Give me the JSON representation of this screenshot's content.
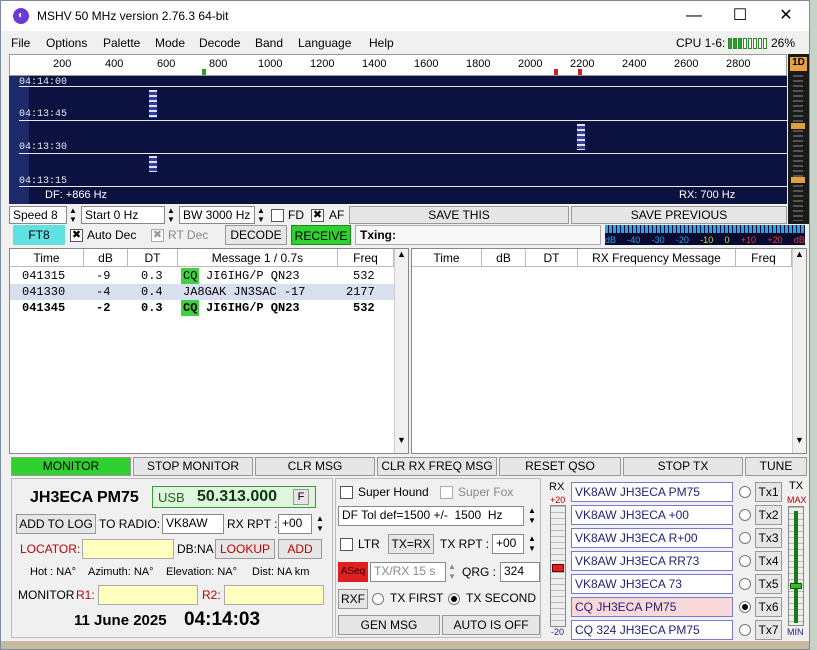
{
  "window": {
    "title": "MSHV 50 MHz version 2.76.3 64-bit",
    "minimize_icon": "minimize-icon",
    "maximize_icon": "maximize-icon",
    "close_icon": "close-icon"
  },
  "menu": [
    "File",
    "Options",
    "Palette",
    "Mode",
    "Decode",
    "Band",
    "Language",
    "Help"
  ],
  "cpu": {
    "label": "CPU 1-6:",
    "percent": "26%",
    "level": 0.26
  },
  "scale": {
    "ticks": [
      "200",
      "400",
      "600",
      "800",
      "1000",
      "1200",
      "1400",
      "1600",
      "1800",
      "2000",
      "2200",
      "2400",
      "2600",
      "2800"
    ]
  },
  "waterfall": {
    "times": [
      "04:14:00",
      "04:13:45",
      "04:13:30",
      "04:13:15"
    ],
    "df": "DF: +866 Hz",
    "rx": "RX: 700 Hz",
    "mode_badge": "1D"
  },
  "controls": {
    "speed": "Speed 8",
    "start": "Start 0 Hz",
    "bw": "BW 3000 Hz",
    "fd": "FD",
    "af": "AF",
    "save_this": "SAVE THIS",
    "save_previous": "SAVE PREVIOUS"
  },
  "status": {
    "mode": "FT8",
    "auto_dec": "Auto Dec",
    "rt_dec": "RT Dec",
    "decode": "DECODE",
    "receive": "RECEIVE",
    "txing": "Txing:",
    "level_scale": [
      "dB",
      "-40",
      "-30",
      "-20",
      "-10",
      "0",
      "+10",
      "+20",
      "dB"
    ]
  },
  "left_table": {
    "headers": [
      "Time",
      "dB",
      "DT",
      "Message 1 / 0.7s",
      "Freq"
    ],
    "rows": [
      {
        "time": "041315",
        "db": "-9",
        "dt": "0.3",
        "cq": "CQ",
        "msg": "JI6IHG/P QN23",
        "freq": "532"
      },
      {
        "time": "041330",
        "db": "-4",
        "dt": "0.4",
        "cq": "",
        "msg": "JA8GAK JN3SAC -17",
        "freq": "2177"
      },
      {
        "time": "041345",
        "db": "-2",
        "dt": "0.3",
        "cq": "CQ",
        "msg": "JI6IHG/P QN23",
        "freq": "532"
      }
    ]
  },
  "right_table": {
    "headers": [
      "Time",
      "dB",
      "DT",
      "RX Frequency Message",
      "Freq"
    ]
  },
  "buttons": {
    "monitor": "MONITOR",
    "stop_monitor": "STOP MONITOR",
    "clr_msg": "CLR MSG",
    "clr_rx": "CLR RX FREQ MSG",
    "reset_qso": "RESET QSO",
    "stop_tx": "STOP TX",
    "tune": "TUNE"
  },
  "station": {
    "call_grid": "JH3ECA PM75",
    "mode": "USB",
    "freq": "50.313.000",
    "f_btn": "F",
    "add_to_log": "ADD TO LOG",
    "to_radio_label": "TO RADIO:",
    "to_radio": "VK8AW",
    "rx_rpt_label": "RX RPT :",
    "rx_rpt": "+00",
    "locator_label": "LOCATOR:",
    "db_label": "DB:NA",
    "lookup": "LOOKUP",
    "add": "ADD",
    "hot": "Hot : NA°",
    "azimuth": "Azimuth: NA°",
    "elevation": "Elevation: NA°",
    "dist": "Dist: NA km",
    "monitor_label": "MONITOR",
    "r1": "R1:",
    "r2": "R2:",
    "date": "11 June 2025",
    "time": "04:14:03"
  },
  "options": {
    "super_hound": "Super Hound",
    "super_fox": "Super Fox",
    "df_tol": "DF Tol def=1500 +/-  1500  Hz",
    "ltr": "LTR",
    "tx_eq_rx": "TX=RX",
    "tx_rpt_label": "TX RPT :",
    "tx_rpt": "+00",
    "aseq": "ASeq",
    "txrx": "TX/RX 15  s",
    "qrg_label": "QRG :",
    "qrg": "324",
    "rxf": "RXF",
    "tx_first": "TX FIRST",
    "tx_second": "TX SECOND",
    "gen_msg": "GEN MSG",
    "auto_off": "AUTO IS OFF"
  },
  "tx_panel": {
    "rx_label": "RX",
    "rx_max": "+20",
    "rx_min": "-20",
    "tx_label": "TX",
    "tx_max": "MAX",
    "tx_min": "MIN",
    "messages": [
      "VK8AW JH3ECA PM75",
      "VK8AW JH3ECA +00",
      "VK8AW JH3ECA R+00",
      "VK8AW JH3ECA RR73",
      "VK8AW JH3ECA 73",
      "CQ JH3ECA PM75",
      "CQ 324 JH3ECA PM75"
    ],
    "buttons": [
      "Tx1",
      "Tx2",
      "Tx3",
      "Tx4",
      "Tx5",
      "Tx6",
      "Tx7"
    ],
    "selected": 5
  }
}
